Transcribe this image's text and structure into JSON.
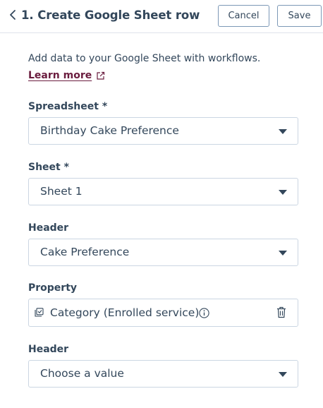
{
  "header": {
    "title": "1. Create Google Sheet row",
    "cancel_label": "Cancel",
    "save_label": "Save"
  },
  "intro": {
    "text": "Add data to your Google Sheet with workflows.",
    "learn_more": "Learn more"
  },
  "fields": {
    "spreadsheet": {
      "label": "Spreadsheet *",
      "value": "Birthday Cake Preference"
    },
    "sheet": {
      "label": "Sheet *",
      "value": "Sheet 1"
    },
    "header1": {
      "label": "Header",
      "value": "Cake Preference"
    },
    "property": {
      "label": "Property",
      "value": "Category (Enrolled service)"
    },
    "header2": {
      "label": "Header",
      "value": "Choose a value"
    }
  },
  "icons": {
    "back": "chevron-left-icon",
    "external": "external-link-icon",
    "caret": "caret-down-icon",
    "property": "property-icon",
    "info": "info-icon",
    "delete": "trash-icon"
  },
  "colors": {
    "text": "#33475b",
    "link": "#6b1d3f",
    "border": "#cbd6e2",
    "button_border": "#7c98b6"
  }
}
